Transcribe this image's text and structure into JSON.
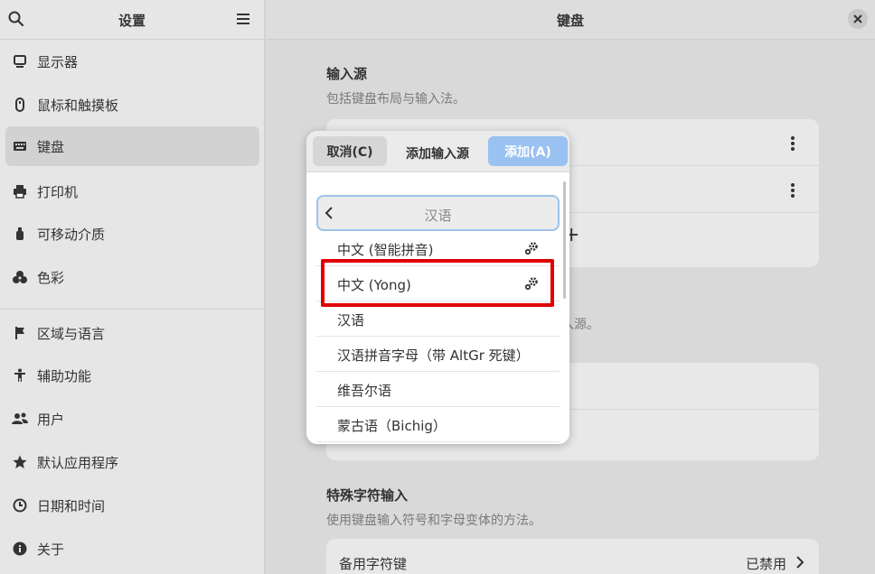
{
  "sidebar": {
    "title": "设置",
    "items": [
      {
        "label": "显示器",
        "icon": "display-icon"
      },
      {
        "label": "鼠标和触摸板",
        "icon": "mouse-icon"
      },
      {
        "label": "键盘",
        "icon": "keyboard-icon",
        "active": true
      },
      {
        "label": "打印机",
        "icon": "printer-icon"
      },
      {
        "label": "可移动介质",
        "icon": "usb-icon"
      },
      {
        "label": "色彩",
        "icon": "color-icon"
      },
      {
        "label": "区域与语言",
        "icon": "flag-icon"
      },
      {
        "label": "辅助功能",
        "icon": "accessibility-icon"
      },
      {
        "label": "用户",
        "icon": "users-icon"
      },
      {
        "label": "默认应用程序",
        "icon": "star-icon"
      },
      {
        "label": "日期和时间",
        "icon": "clock-icon"
      },
      {
        "label": "关于",
        "icon": "info-icon"
      }
    ]
  },
  "main": {
    "title": "键盘",
    "input_sources": {
      "title": "输入源",
      "subtitle": "包括键盘布局与输入法。",
      "add_symbol": "+"
    },
    "hidden_subtitle_fragment": "入源。",
    "special": {
      "title": "特殊字符输入",
      "subtitle": "使用键盘输入符号和字母变体的方法。",
      "alt_key_label": "备用字符键",
      "alt_key_value": "已禁用"
    }
  },
  "dialog": {
    "cancel_label": "取消(C)",
    "title": "添加输入源",
    "add_label": "添加(A)",
    "language": "汉语",
    "items": [
      {
        "label": "中文 (智能拼音)",
        "has_settings": true
      },
      {
        "label": "中文 (Yong)",
        "has_settings": true,
        "highlighted": true
      },
      {
        "label": "汉语",
        "has_settings": false
      },
      {
        "label": "汉语拼音字母（带 AltGr 死键）",
        "has_settings": false
      },
      {
        "label": "维吾尔语",
        "has_settings": false
      },
      {
        "label": "蒙古语（Bichig）",
        "has_settings": false
      }
    ]
  },
  "colors": {
    "accent": "#99c1f1",
    "highlight": "#e00000"
  }
}
